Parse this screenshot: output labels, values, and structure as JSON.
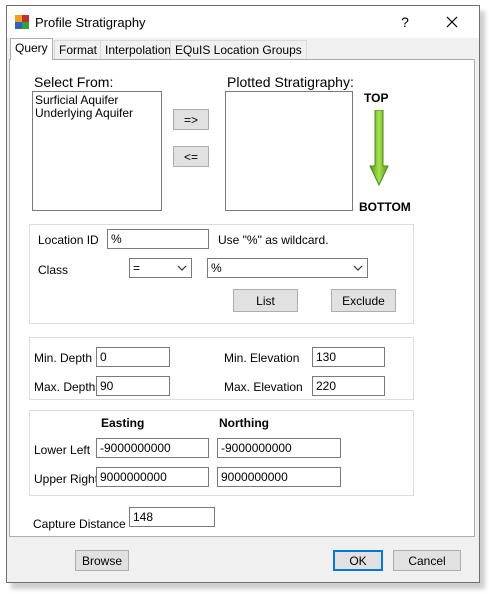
{
  "window": {
    "title": "Profile Stratigraphy",
    "help_label": "?",
    "close_label": "✕"
  },
  "tabs": [
    "Query",
    "Format",
    "Interpolation",
    "EQuIS Location Groups"
  ],
  "query": {
    "select_from_label": "Select From:",
    "select_from_items": [
      "Surficial Aquifer",
      "Underlying Aquifer"
    ],
    "plotted_label": "Plotted Stratigraphy:",
    "plotted_items": [],
    "add_button": "=>",
    "remove_button": "<=",
    "top_label": "TOP",
    "bottom_label": "BOTTOM",
    "arrow_color": "#6fbf1f",
    "location": {
      "label": "Location ID",
      "value": "%",
      "hint": "Use \"%\" as wildcard.",
      "class_label": "Class",
      "class_operator": "=",
      "class_value": "%",
      "list_button": "List",
      "exclude_button": "Exclude"
    },
    "depth": {
      "min_depth_label": "Min. Depth",
      "min_depth_value": "0",
      "max_depth_label": "Max. Depth",
      "max_depth_value": "90",
      "min_elev_label": "Min. Elevation",
      "min_elev_value": "130",
      "max_elev_label": "Max. Elevation",
      "max_elev_value": "220"
    },
    "extent": {
      "easting_label": "Easting",
      "northing_label": "Northing",
      "lower_left_label": "Lower Left",
      "lower_left_easting": "-9000000000",
      "lower_left_northing": "-9000000000",
      "upper_right_label": "Upper Right",
      "upper_right_easting": "9000000000",
      "upper_right_northing": "9000000000"
    },
    "capture_distance_label": "Capture Distance",
    "capture_distance_value": "148"
  },
  "footer": {
    "browse_button": "Browse",
    "ok_button": "OK",
    "cancel_button": "Cancel"
  }
}
